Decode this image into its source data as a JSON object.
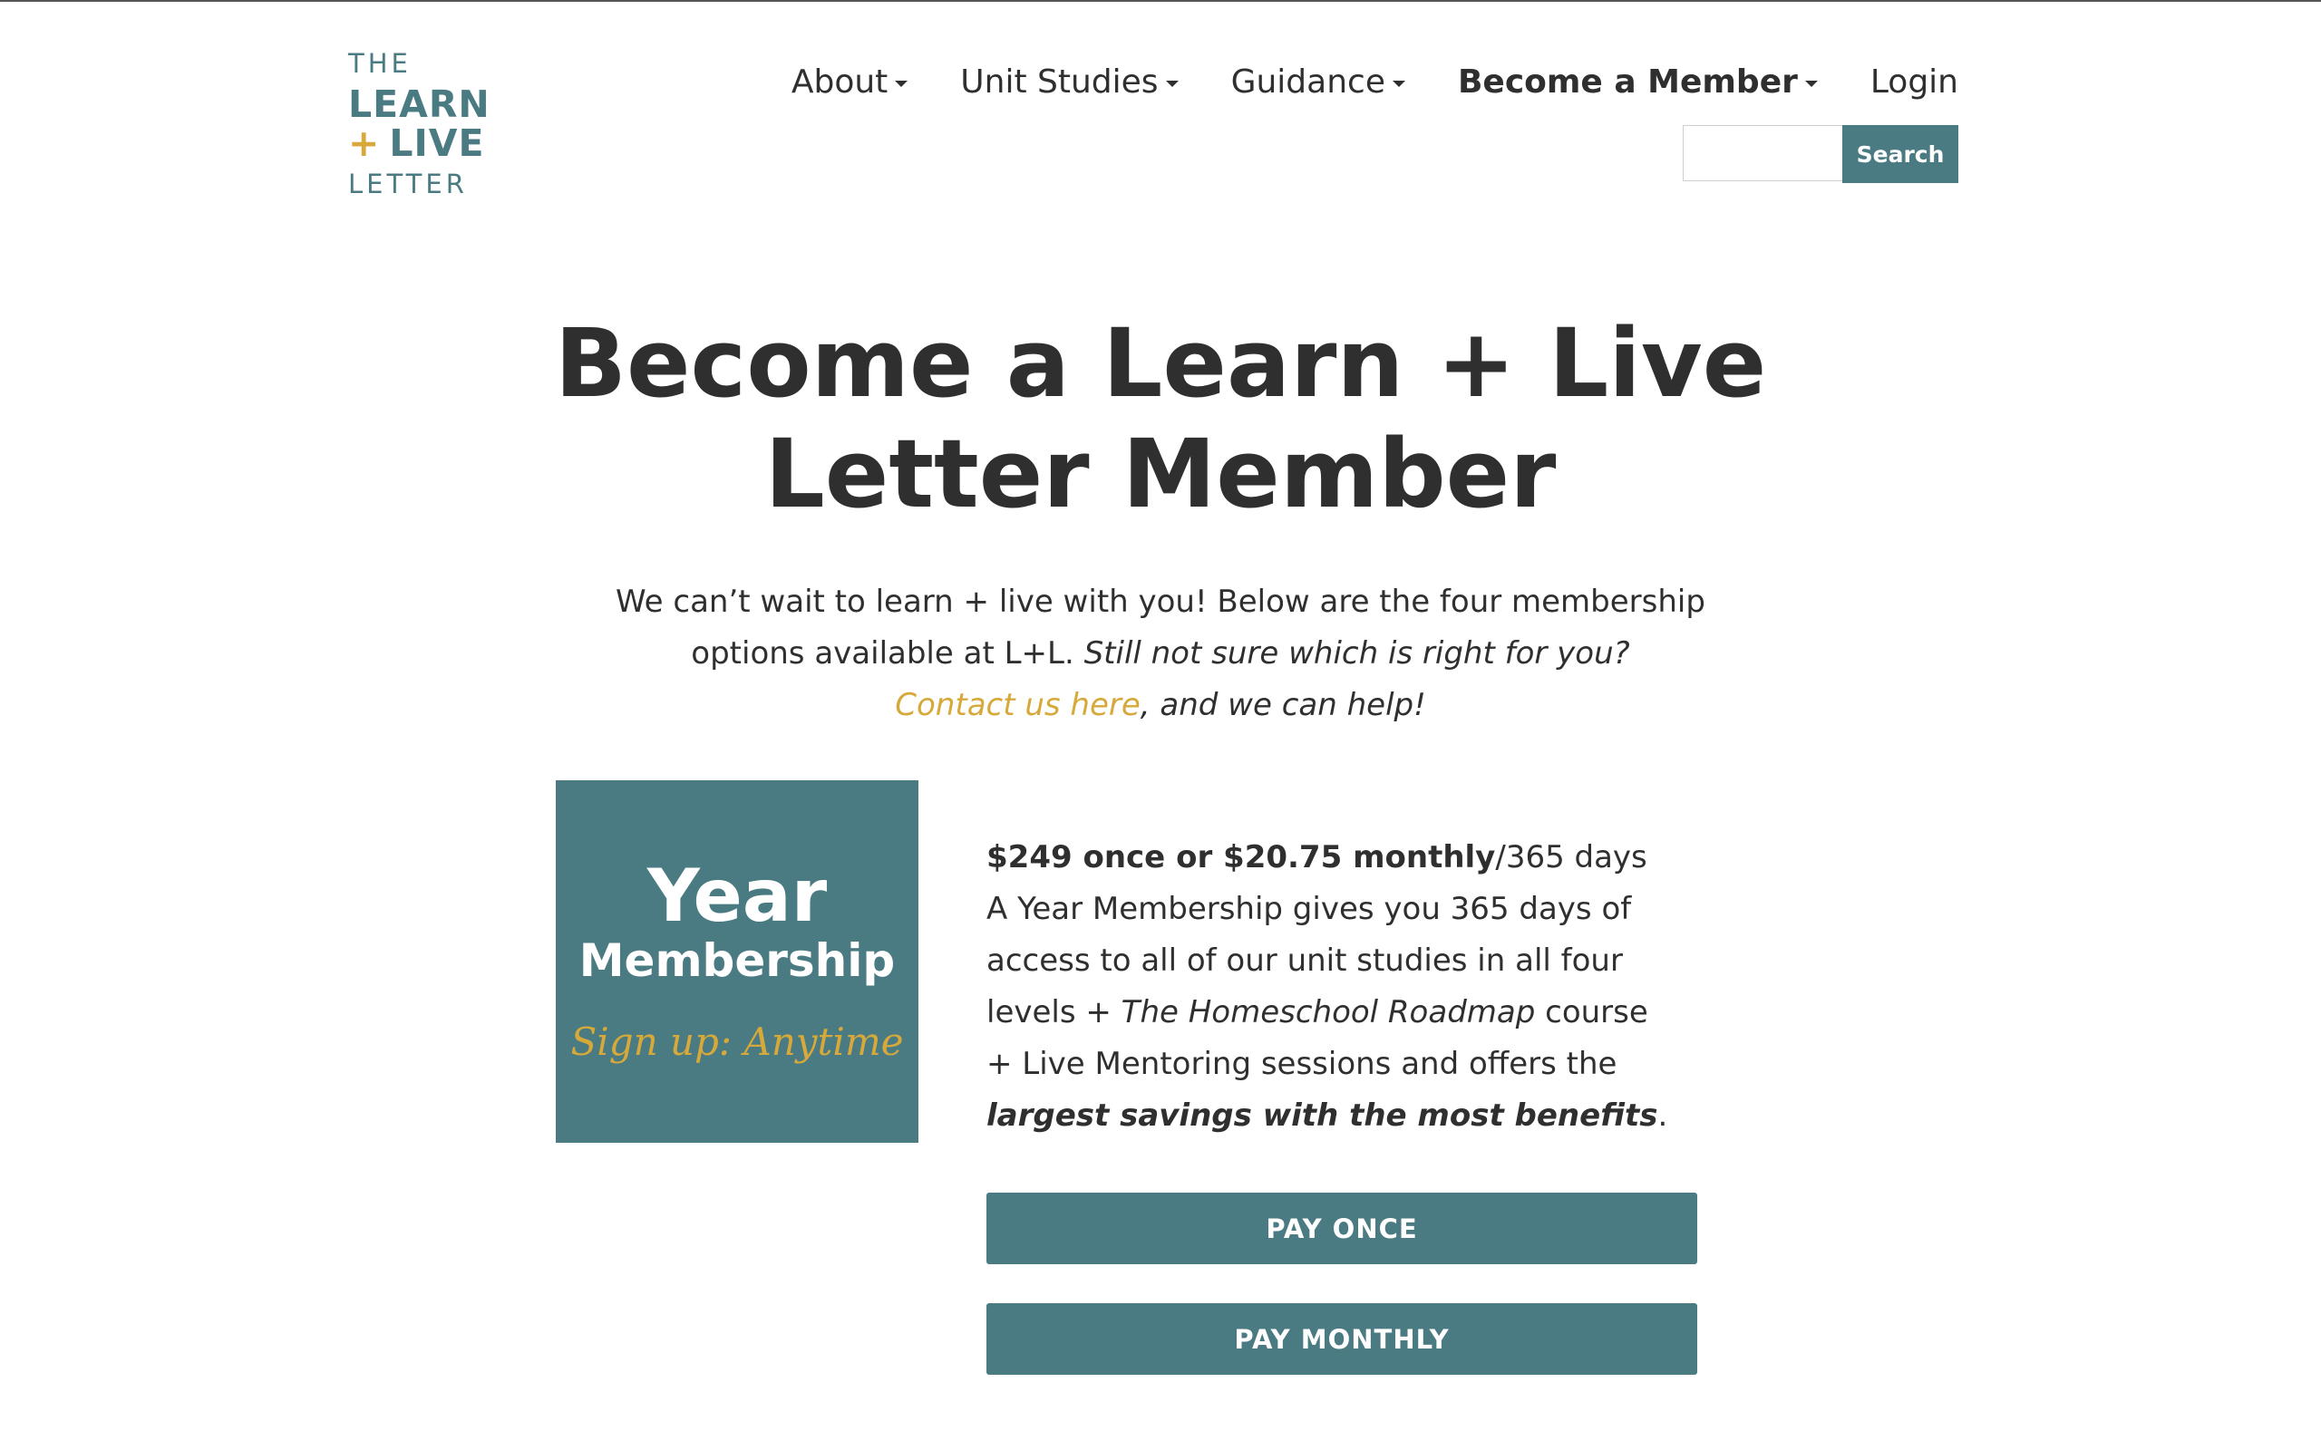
{
  "logo": {
    "line1": "THE",
    "line2": "LEARN",
    "plus": "+",
    "line3": "LIVE",
    "line4": "LETTER"
  },
  "nav": {
    "items": [
      {
        "label": "About",
        "has_dropdown": true
      },
      {
        "label": "Unit Studies",
        "has_dropdown": true
      },
      {
        "label": "Guidance",
        "has_dropdown": true
      },
      {
        "label": "Become a Member",
        "has_dropdown": true,
        "active": true
      },
      {
        "label": "Login",
        "has_dropdown": false
      }
    ]
  },
  "search": {
    "value": "",
    "button_label": "Search"
  },
  "page": {
    "title_line1": "Become a Learn + Live",
    "title_line2": "Letter Member",
    "intro_part1": "We can’t wait to learn + live with you! Below are the four membership options available at L+L. ",
    "intro_italic": "Still not sure which is right for you?",
    "contact_link": "Contact us here",
    "intro_end": ", and we can help!"
  },
  "card": {
    "image": {
      "title": "Year",
      "subtitle": "Membership",
      "tagline": "Sign up: Anytime"
    },
    "price": "$249 once or $20.75 monthly",
    "duration": "/365 days",
    "desc_part1": "A Year Membership gives you 365 days of access to all of our unit studies in all four levels + ",
    "desc_course": "The Homeschool Roadmap",
    "desc_part2": " course + Live Mentoring sessions and offers the ",
    "desc_emphasis": "largest savings with the most benefits",
    "desc_end": ".",
    "pay_once_label": "PAY ONCE",
    "pay_monthly_label": "PAY MONTHLY"
  },
  "colors": {
    "accent": "#4b7b82",
    "gold": "#d6a93a",
    "text": "#2f2f2f"
  }
}
